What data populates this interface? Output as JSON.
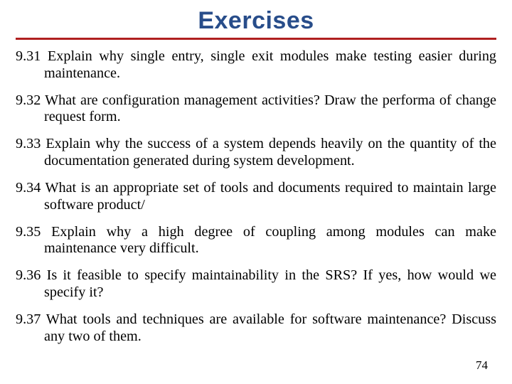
{
  "title": "Exercises",
  "items": [
    {
      "num": "9.31",
      "text": "Explain why single entry, single exit modules make testing easier during maintenance."
    },
    {
      "num": "9.32",
      "text": "What are configuration management activities? Draw the performa of change request form."
    },
    {
      "num": "9.33",
      "text": "Explain why the success of a system depends heavily on the quantity of the documentation generated during system development."
    },
    {
      "num": "9.34",
      "text": "What is an appropriate set of tools and documents required to maintain large software product/"
    },
    {
      "num": "9.35",
      "text": "Explain why a high degree of coupling among modules can make maintenance very difficult."
    },
    {
      "num": "9.36",
      "text": "Is it feasible to specify maintainability in the SRS? If yes, how would we specify it?"
    },
    {
      "num": "9.37",
      "text": "What tools and techniques are available for software maintenance? Discuss any two of them."
    }
  ],
  "page_number": "74"
}
